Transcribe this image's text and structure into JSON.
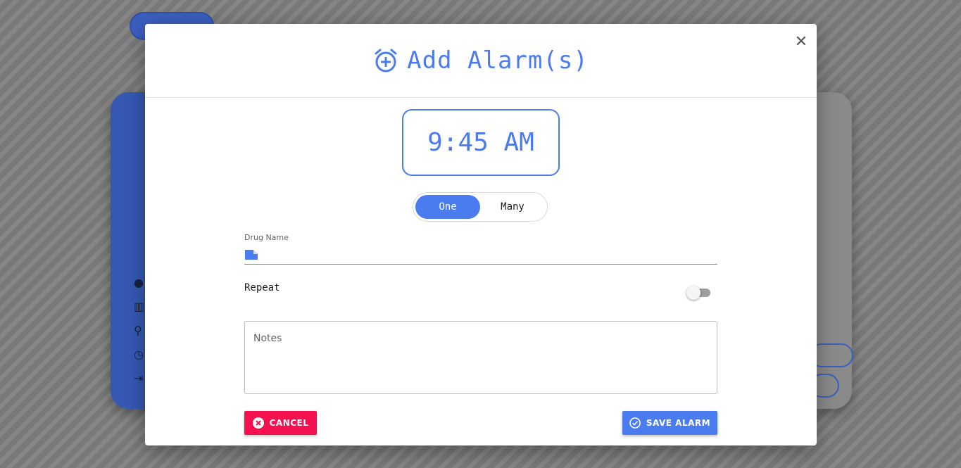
{
  "modal": {
    "title": "Add Alarm(s)",
    "time": "9:45 AM",
    "toggle": {
      "options": [
        "One",
        "Many"
      ],
      "selected": "One"
    },
    "drug_name": {
      "label": "Drug Name",
      "value": ""
    },
    "repeat": {
      "label": "Repeat",
      "enabled": false
    },
    "notes": {
      "placeholder": "Notes"
    },
    "cancel_label": "CANCEL",
    "save_label": "SAVE ALARM"
  },
  "colors": {
    "accent": "#4a7cf0",
    "cancel": "#f5104f"
  },
  "icons": [
    "alarm-add-icon",
    "close-icon",
    "note-icon",
    "cancel-circle-icon",
    "check-circle-icon"
  ]
}
